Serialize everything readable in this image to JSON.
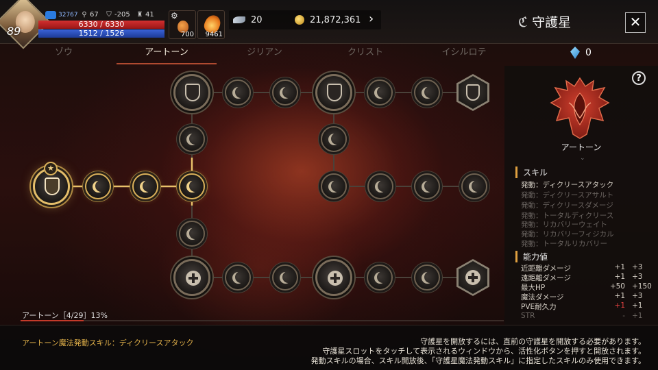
{
  "player": {
    "level": "89",
    "power": "32767",
    "stat_key": "67",
    "stat_helmet": "-205",
    "stat_trophy": "41",
    "hp": "6330 / 6330",
    "mp": "1512 / 1526",
    "potion_count": "700",
    "item_count": "9461"
  },
  "currency": {
    "feather": "20",
    "gold": "21,872,361"
  },
  "header": {
    "title": "守護星"
  },
  "tabs": [
    {
      "label": "ゾウ"
    },
    {
      "label": "アートーン"
    },
    {
      "label": "ジリアン"
    },
    {
      "label": "クリスト"
    },
    {
      "label": "イシルロテ"
    }
  ],
  "active_tab": "アートーン",
  "gem_count": "0",
  "panel": {
    "name": "アートーン",
    "skills_title": "スキル",
    "skills": [
      "発動：ディクリースアタック",
      "発動：ディクリースアサルト",
      "発動：ディクリースダメージ",
      "発動：トータルディクリース",
      "発動：リカバリーウェイト",
      "発動：リカバリーフィジカル",
      "発動：トータルリカバリー"
    ],
    "abilities_title": "能力値",
    "abilities": [
      {
        "name": "近距離ダメージ",
        "a": "+1",
        "b": "+3"
      },
      {
        "name": "遠距離ダメージ",
        "a": "+1",
        "b": "+3"
      },
      {
        "name": "最大HP",
        "a": "+50",
        "b": "+150"
      },
      {
        "name": "魔法ダメージ",
        "a": "+1",
        "b": "+3"
      },
      {
        "name": "PVE耐久力",
        "a": "+1",
        "b": "+1"
      },
      {
        "name": "STR",
        "a": "-",
        "b": "+1"
      }
    ]
  },
  "progress": {
    "label": "アートーン［4/29］13%",
    "fraction": 0.13
  },
  "footer": {
    "skill_text": "アートーン魔法発動スキル：ディクリースアタック",
    "notes": [
      "守護星を開放するには、直前の守護星を開放する必要があります。",
      "守護星スロットをタッチして表示されるウィンドウから、活性化ボタンを押すと開放されます。",
      "発動スキルの場合、スキル開放後、「守護星魔法発動スキル」に指定したスキルのみ使用できます。"
    ]
  },
  "colors": {
    "accent_gold": "#e3b24a",
    "tab_underline": "#b04a30",
    "hp": "#d23030",
    "mp": "#3a62d8"
  }
}
